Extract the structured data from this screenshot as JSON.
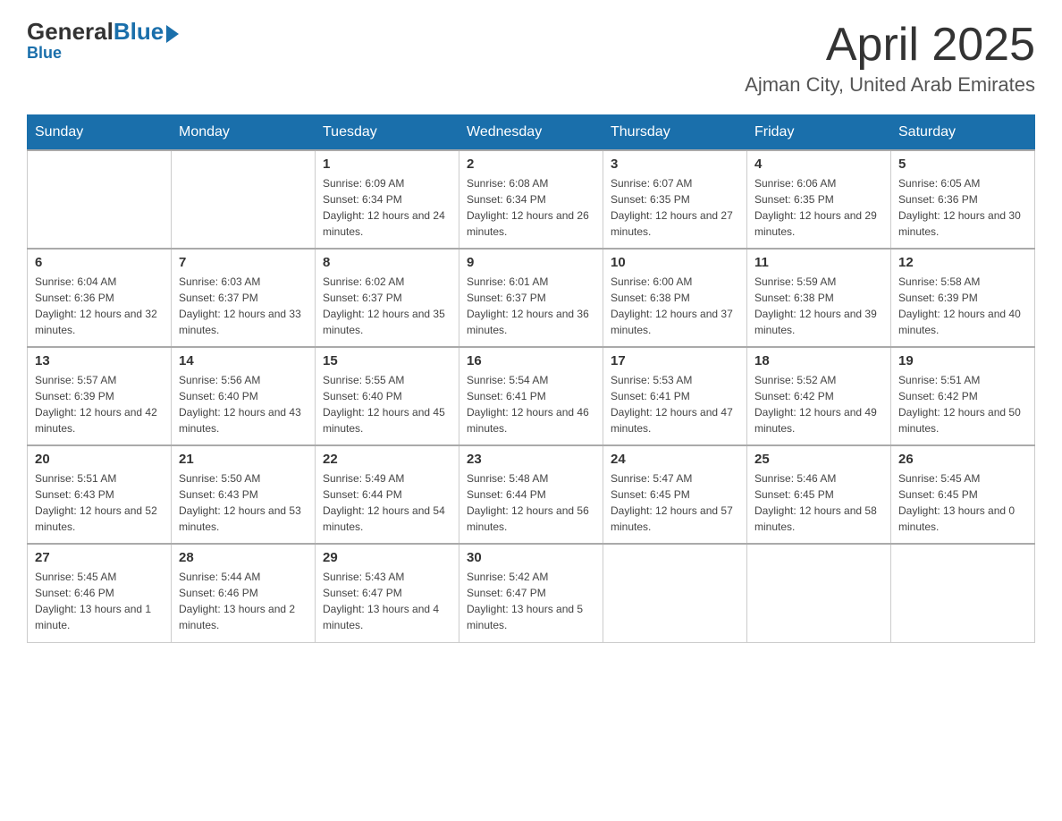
{
  "header": {
    "logo": {
      "general": "General",
      "blue": "Blue"
    },
    "title": "April 2025",
    "location": "Ajman City, United Arab Emirates"
  },
  "calendar": {
    "days_of_week": [
      "Sunday",
      "Monday",
      "Tuesday",
      "Wednesday",
      "Thursday",
      "Friday",
      "Saturday"
    ],
    "weeks": [
      [
        {
          "day": "",
          "sunrise": "",
          "sunset": "",
          "daylight": ""
        },
        {
          "day": "",
          "sunrise": "",
          "sunset": "",
          "daylight": ""
        },
        {
          "day": "1",
          "sunrise": "Sunrise: 6:09 AM",
          "sunset": "Sunset: 6:34 PM",
          "daylight": "Daylight: 12 hours and 24 minutes."
        },
        {
          "day": "2",
          "sunrise": "Sunrise: 6:08 AM",
          "sunset": "Sunset: 6:34 PM",
          "daylight": "Daylight: 12 hours and 26 minutes."
        },
        {
          "day": "3",
          "sunrise": "Sunrise: 6:07 AM",
          "sunset": "Sunset: 6:35 PM",
          "daylight": "Daylight: 12 hours and 27 minutes."
        },
        {
          "day": "4",
          "sunrise": "Sunrise: 6:06 AM",
          "sunset": "Sunset: 6:35 PM",
          "daylight": "Daylight: 12 hours and 29 minutes."
        },
        {
          "day": "5",
          "sunrise": "Sunrise: 6:05 AM",
          "sunset": "Sunset: 6:36 PM",
          "daylight": "Daylight: 12 hours and 30 minutes."
        }
      ],
      [
        {
          "day": "6",
          "sunrise": "Sunrise: 6:04 AM",
          "sunset": "Sunset: 6:36 PM",
          "daylight": "Daylight: 12 hours and 32 minutes."
        },
        {
          "day": "7",
          "sunrise": "Sunrise: 6:03 AM",
          "sunset": "Sunset: 6:37 PM",
          "daylight": "Daylight: 12 hours and 33 minutes."
        },
        {
          "day": "8",
          "sunrise": "Sunrise: 6:02 AM",
          "sunset": "Sunset: 6:37 PM",
          "daylight": "Daylight: 12 hours and 35 minutes."
        },
        {
          "day": "9",
          "sunrise": "Sunrise: 6:01 AM",
          "sunset": "Sunset: 6:37 PM",
          "daylight": "Daylight: 12 hours and 36 minutes."
        },
        {
          "day": "10",
          "sunrise": "Sunrise: 6:00 AM",
          "sunset": "Sunset: 6:38 PM",
          "daylight": "Daylight: 12 hours and 37 minutes."
        },
        {
          "day": "11",
          "sunrise": "Sunrise: 5:59 AM",
          "sunset": "Sunset: 6:38 PM",
          "daylight": "Daylight: 12 hours and 39 minutes."
        },
        {
          "day": "12",
          "sunrise": "Sunrise: 5:58 AM",
          "sunset": "Sunset: 6:39 PM",
          "daylight": "Daylight: 12 hours and 40 minutes."
        }
      ],
      [
        {
          "day": "13",
          "sunrise": "Sunrise: 5:57 AM",
          "sunset": "Sunset: 6:39 PM",
          "daylight": "Daylight: 12 hours and 42 minutes."
        },
        {
          "day": "14",
          "sunrise": "Sunrise: 5:56 AM",
          "sunset": "Sunset: 6:40 PM",
          "daylight": "Daylight: 12 hours and 43 minutes."
        },
        {
          "day": "15",
          "sunrise": "Sunrise: 5:55 AM",
          "sunset": "Sunset: 6:40 PM",
          "daylight": "Daylight: 12 hours and 45 minutes."
        },
        {
          "day": "16",
          "sunrise": "Sunrise: 5:54 AM",
          "sunset": "Sunset: 6:41 PM",
          "daylight": "Daylight: 12 hours and 46 minutes."
        },
        {
          "day": "17",
          "sunrise": "Sunrise: 5:53 AM",
          "sunset": "Sunset: 6:41 PM",
          "daylight": "Daylight: 12 hours and 47 minutes."
        },
        {
          "day": "18",
          "sunrise": "Sunrise: 5:52 AM",
          "sunset": "Sunset: 6:42 PM",
          "daylight": "Daylight: 12 hours and 49 minutes."
        },
        {
          "day": "19",
          "sunrise": "Sunrise: 5:51 AM",
          "sunset": "Sunset: 6:42 PM",
          "daylight": "Daylight: 12 hours and 50 minutes."
        }
      ],
      [
        {
          "day": "20",
          "sunrise": "Sunrise: 5:51 AM",
          "sunset": "Sunset: 6:43 PM",
          "daylight": "Daylight: 12 hours and 52 minutes."
        },
        {
          "day": "21",
          "sunrise": "Sunrise: 5:50 AM",
          "sunset": "Sunset: 6:43 PM",
          "daylight": "Daylight: 12 hours and 53 minutes."
        },
        {
          "day": "22",
          "sunrise": "Sunrise: 5:49 AM",
          "sunset": "Sunset: 6:44 PM",
          "daylight": "Daylight: 12 hours and 54 minutes."
        },
        {
          "day": "23",
          "sunrise": "Sunrise: 5:48 AM",
          "sunset": "Sunset: 6:44 PM",
          "daylight": "Daylight: 12 hours and 56 minutes."
        },
        {
          "day": "24",
          "sunrise": "Sunrise: 5:47 AM",
          "sunset": "Sunset: 6:45 PM",
          "daylight": "Daylight: 12 hours and 57 minutes."
        },
        {
          "day": "25",
          "sunrise": "Sunrise: 5:46 AM",
          "sunset": "Sunset: 6:45 PM",
          "daylight": "Daylight: 12 hours and 58 minutes."
        },
        {
          "day": "26",
          "sunrise": "Sunrise: 5:45 AM",
          "sunset": "Sunset: 6:45 PM",
          "daylight": "Daylight: 13 hours and 0 minutes."
        }
      ],
      [
        {
          "day": "27",
          "sunrise": "Sunrise: 5:45 AM",
          "sunset": "Sunset: 6:46 PM",
          "daylight": "Daylight: 13 hours and 1 minute."
        },
        {
          "day": "28",
          "sunrise": "Sunrise: 5:44 AM",
          "sunset": "Sunset: 6:46 PM",
          "daylight": "Daylight: 13 hours and 2 minutes."
        },
        {
          "day": "29",
          "sunrise": "Sunrise: 5:43 AM",
          "sunset": "Sunset: 6:47 PM",
          "daylight": "Daylight: 13 hours and 4 minutes."
        },
        {
          "day": "30",
          "sunrise": "Sunrise: 5:42 AM",
          "sunset": "Sunset: 6:47 PM",
          "daylight": "Daylight: 13 hours and 5 minutes."
        },
        {
          "day": "",
          "sunrise": "",
          "sunset": "",
          "daylight": ""
        },
        {
          "day": "",
          "sunrise": "",
          "sunset": "",
          "daylight": ""
        },
        {
          "day": "",
          "sunrise": "",
          "sunset": "",
          "daylight": ""
        }
      ]
    ]
  }
}
